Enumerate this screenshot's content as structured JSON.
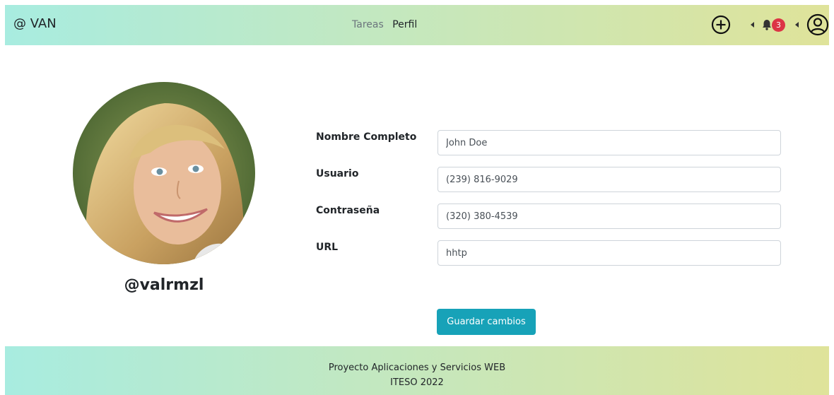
{
  "header": {
    "brand": "@ VAN",
    "nav": [
      {
        "label": "Tareas"
      },
      {
        "label": "Perfil"
      }
    ],
    "notifications_count": "3",
    "icons": {
      "add": "plus-circle-icon",
      "notifications": "bell-icon",
      "account": "user-circle-icon"
    }
  },
  "profile": {
    "username": "@valrmzl",
    "avatar_icon": "profile-photo"
  },
  "form": {
    "fields": [
      {
        "label": "Nombre Completo",
        "value": "John Doe"
      },
      {
        "label": "Usuario",
        "value": "(239) 816-9029"
      },
      {
        "label": "Contraseña",
        "value": "(320) 380-4539"
      },
      {
        "label": "URL",
        "value": "hhtp"
      }
    ],
    "save_label": "Guardar cambios"
  },
  "footer": {
    "line1": "Proyecto Aplicaciones y Servicios WEB",
    "line2": "ITESO 2022"
  },
  "colors": {
    "accent": "#17a2b8",
    "badge": "#dc3545",
    "gradient_start": "#a8ece0",
    "gradient_end": "#dfe39a"
  }
}
